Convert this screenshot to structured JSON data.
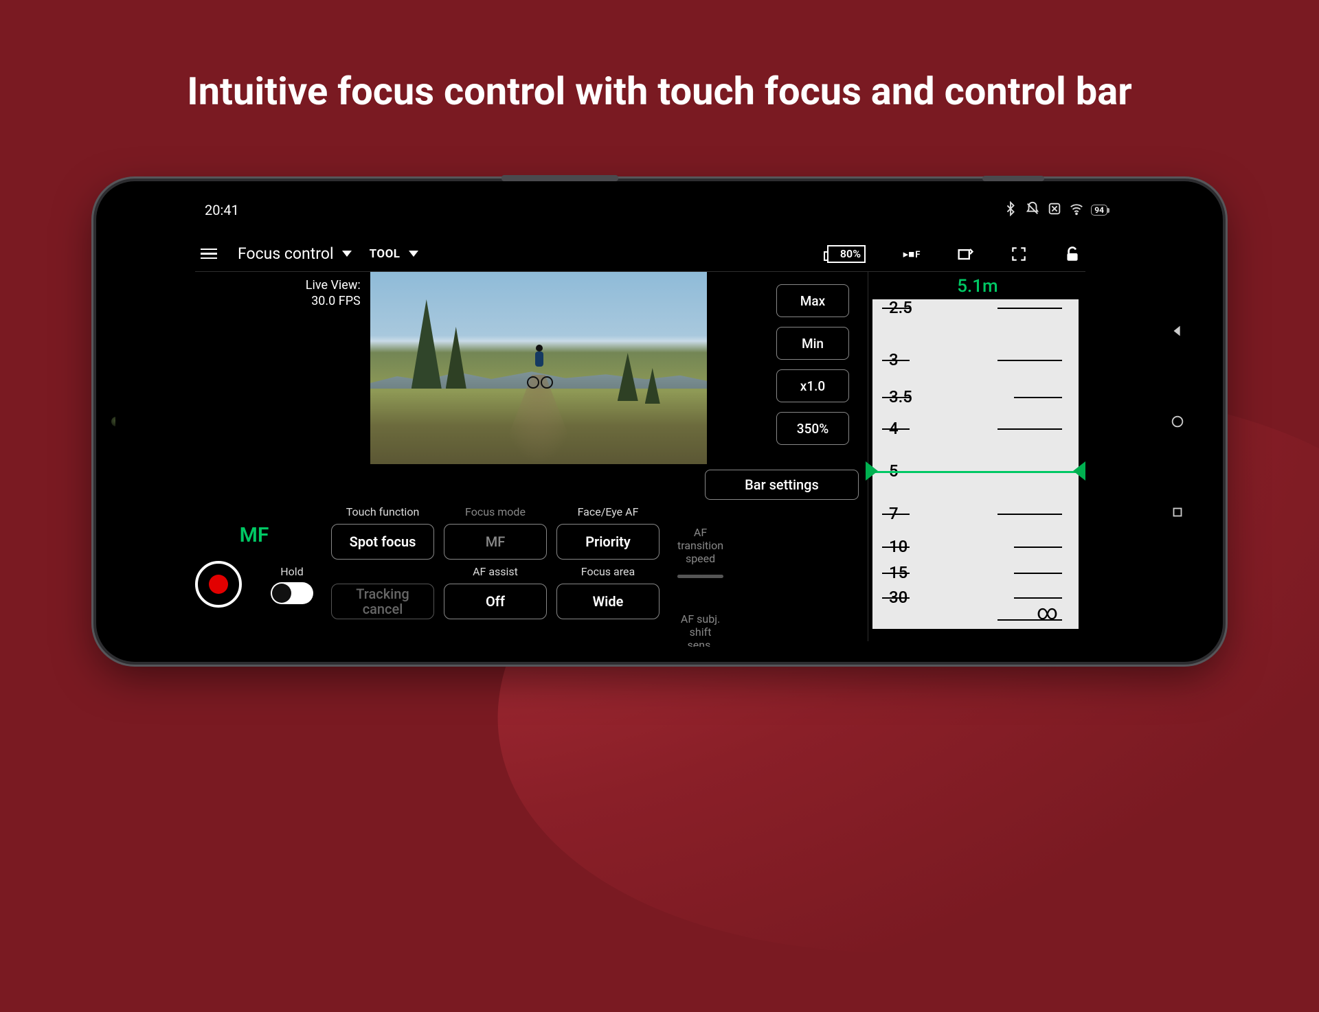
{
  "headline": "Intuitive focus control with touch focus and control bar",
  "statusbar": {
    "time": "20:41",
    "battery_pct": "94"
  },
  "toolbar": {
    "mode_label": "Focus control",
    "tool_label": "TOOL",
    "battery_pct": "80%"
  },
  "liveview": {
    "label1": "Live View:",
    "label2": "30.0 FPS"
  },
  "quick_buttons": {
    "max": "Max",
    "min": "Min",
    "mag1": "x1.0",
    "mag2": "350%"
  },
  "bar_settings": "Bar settings",
  "mf_indicator": "MF",
  "hold_label": "Hold",
  "controls": {
    "touch_function": {
      "label": "Touch function",
      "value": "Spot focus"
    },
    "focus_mode": {
      "label": "Focus mode",
      "value": "MF"
    },
    "face_eye_af": {
      "label": "Face/Eye AF",
      "value": "Priority"
    },
    "tracking_cancel": {
      "value": "Tracking cancel"
    },
    "af_assist": {
      "label": "AF assist",
      "value": "Off"
    },
    "focus_area": {
      "label": "Focus area",
      "value": "Wide"
    }
  },
  "sliders": {
    "transition_speed": "AF transition speed",
    "shift_sens": "AF subj. shift sens."
  },
  "ruler": {
    "current_value": "5.1m",
    "labels": [
      "2.5",
      "3",
      "3.5",
      "4",
      "5",
      "7",
      "10",
      "15",
      "30"
    ],
    "infinity": "∞",
    "current_pos_pct": 50
  }
}
